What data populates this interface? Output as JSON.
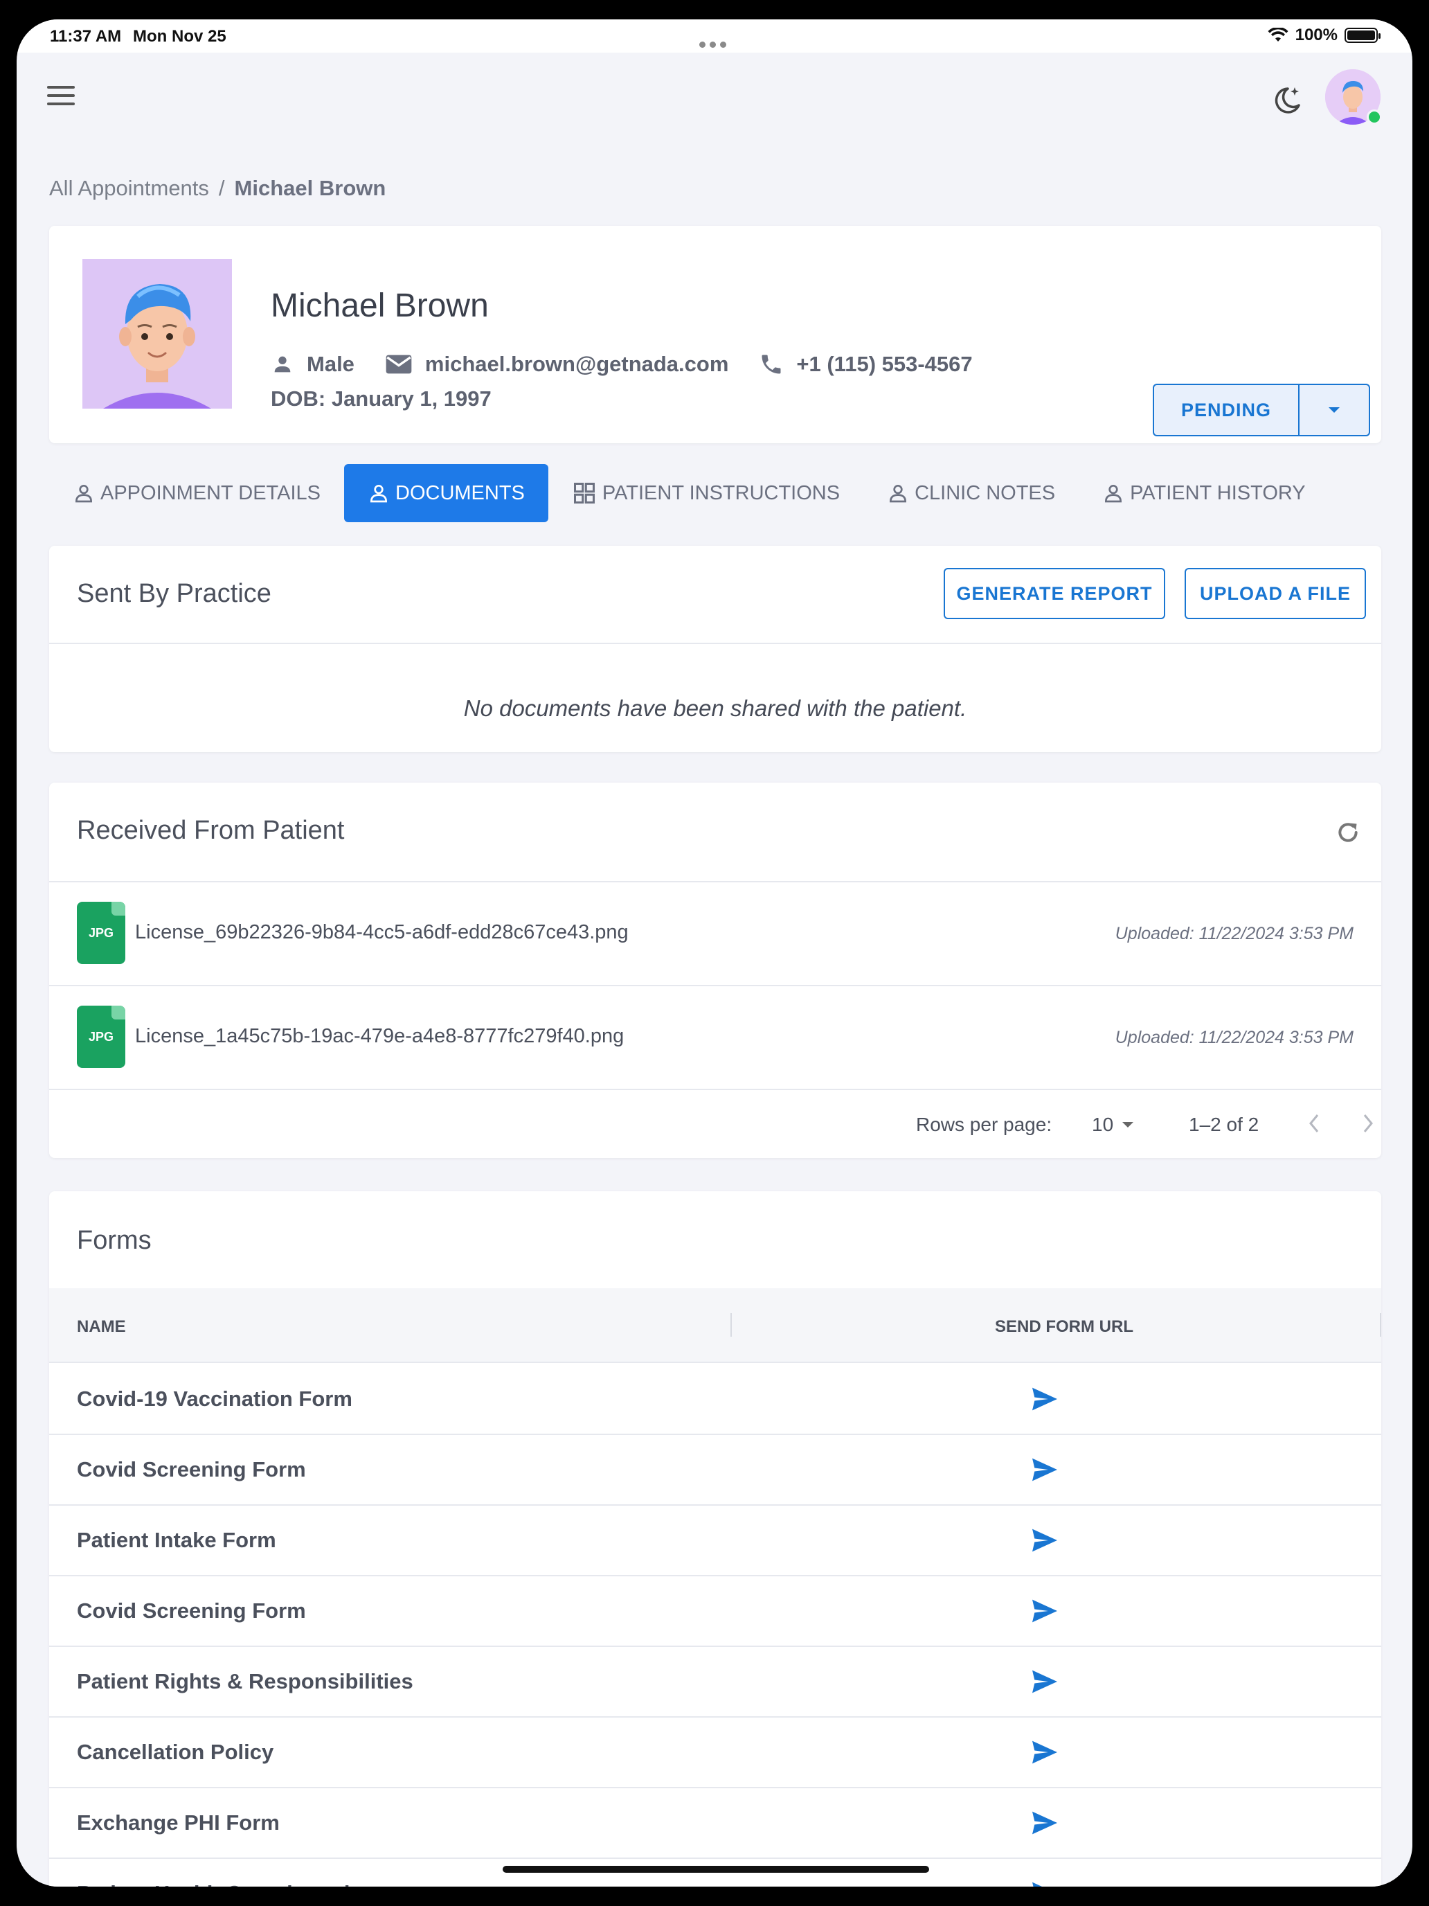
{
  "statusbar": {
    "time": "11:37 AM",
    "date": "Mon Nov 25",
    "battery": "100%"
  },
  "breadcrumb": {
    "parent": "All Appointments",
    "separator": "/",
    "current": "Michael Brown"
  },
  "patient": {
    "name": "Michael Brown",
    "gender": "Male",
    "email": "michael.brown@getnada.com",
    "phone": "+1 (115) 553-4567",
    "dob": "DOB: January 1, 1997",
    "status": "PENDING"
  },
  "tabs": [
    {
      "label": "APPOINMENT DETAILS",
      "icon": "person-outline-icon",
      "active": false
    },
    {
      "label": "DOCUMENTS",
      "icon": "person-outline-icon",
      "active": true
    },
    {
      "label": "PATIENT INSTRUCTIONS",
      "icon": "grid-icon",
      "active": false
    },
    {
      "label": "CLINIC NOTES",
      "icon": "person-outline-icon",
      "active": false
    },
    {
      "label": "PATIENT HISTORY",
      "icon": "person-outline-icon",
      "active": false
    }
  ],
  "sent": {
    "title": "Sent By Practice",
    "generate_label": "GENERATE REPORT",
    "upload_label": "UPLOAD A FILE",
    "empty_message": "No documents have been shared with the patient."
  },
  "received": {
    "title": "Received From Patient",
    "files": [
      {
        "type": "JPG",
        "name": "License_69b22326-9b84-4cc5-a6df-edd28c67ce43.png",
        "uploaded": "Uploaded: 11/22/2024 3:53 PM"
      },
      {
        "type": "JPG",
        "name": "License_1a45c75b-19ac-479e-a4e8-8777fc279f40.png",
        "uploaded": "Uploaded: 11/22/2024 3:53 PM"
      }
    ],
    "pagination": {
      "rows_label": "Rows per page:",
      "rows_value": "10",
      "range": "1–2 of 2"
    }
  },
  "forms": {
    "title": "Forms",
    "col_name": "NAME",
    "col_url": "SEND FORM URL",
    "rows": [
      "Covid-19 Vaccination Form",
      "Covid Screening Form",
      "Patient Intake Form",
      "Covid Screening Form",
      "Patient Rights & Responsibilities",
      "Cancellation Policy",
      "Exchange PHI Form",
      "Patient Health Questionnaire"
    ]
  },
  "colors": {
    "accent": "#1976d2",
    "active_tab": "#1e7ae8",
    "file_icon": "#1aa260",
    "online": "#22c55e"
  }
}
